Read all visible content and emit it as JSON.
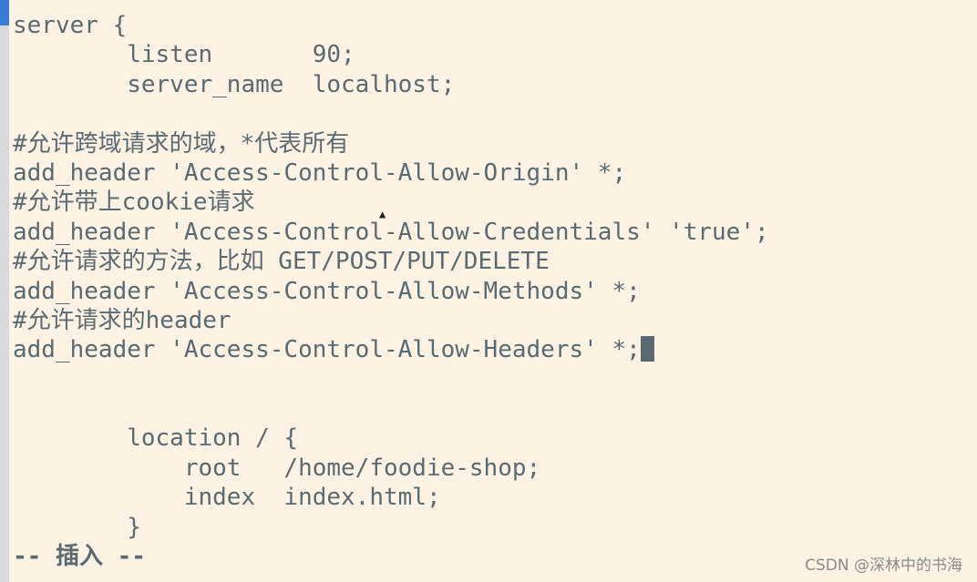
{
  "editor": {
    "lines": [
      "server {",
      "        listen       90;",
      "        server_name  localhost;",
      "",
      "#允许跨域请求的域，*代表所有",
      "add_header 'Access-Control-Allow-Origin' *;",
      "#允许带上cookie请求",
      "add_header 'Access-Control-Allow-Credentials' 'true';",
      "#允许请求的方法，比如 GET/POST/PUT/DELETE",
      "add_header 'Access-Control-Allow-Methods' *;",
      "#允许请求的header",
      "add_header 'Access-Control-Allow-Headers' *;",
      "",
      "",
      "        location / {",
      "            root   /home/foodie-shop;",
      "            index  index.html;",
      "        }"
    ],
    "mode": "-- 插入 --"
  },
  "watermark": "CSDN @深林中的书海",
  "colors": {
    "background": "#fdf2e3",
    "text": "#5a6a72"
  }
}
